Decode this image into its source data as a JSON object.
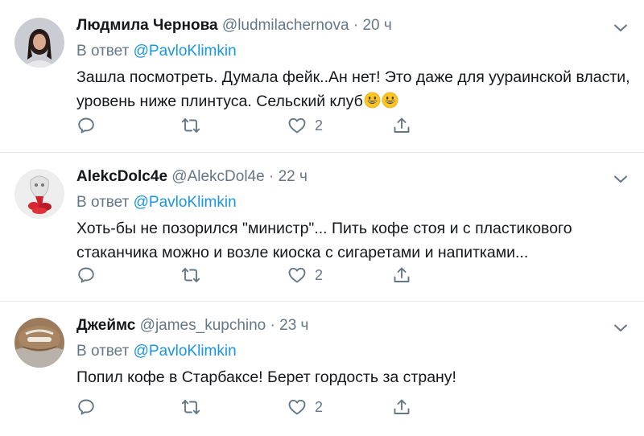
{
  "reply_prefix": "В ответ",
  "icons": {
    "reply": "reply-icon",
    "retweet": "retweet-icon",
    "like": "heart-icon",
    "share": "share-icon",
    "menu": "chevron-down-icon"
  },
  "colors": {
    "link": "#1b95e0",
    "secondary": "#657786",
    "text": "#14171a"
  },
  "tweets": [
    {
      "name": "Людмила Чернова",
      "handle": "@ludmilachernova",
      "separator": "·",
      "time": "20 ч",
      "reply_to": "@PavloKlimkin",
      "text": "Зашла посмотреть. Думала фейк..Ан нет!  Это даже для уураинской власти, уровень ниже плинтуса. Сельский клуб",
      "emoji": [
        "grinning-face",
        "grinning-face"
      ],
      "likes": "2"
    },
    {
      "name": "AlekcDolc4e",
      "handle": "@AlekcDol4e",
      "separator": "·",
      "time": "22 ч",
      "reply_to": "@PavloKlimkin",
      "text": "Хоть-бы не позорился \"министр\"... Пить кофе стоя и с пластикового стаканчика можно и возле киоска с сигаретами и напитками...",
      "likes": "2"
    },
    {
      "name": "Джеймс",
      "handle": "@james_kupchino",
      "separator": "·",
      "time": "23 ч",
      "reply_to": "@PavloKlimkin",
      "text": "Попил кофе в Старбаксе! Берет гордость за страну!",
      "likes": "2"
    }
  ]
}
